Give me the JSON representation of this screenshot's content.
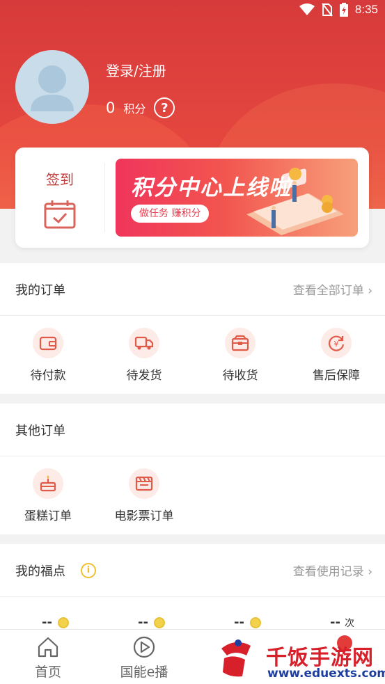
{
  "status_bar": {
    "time": "8:35"
  },
  "profile": {
    "login_label": "登录/注册",
    "points_value": "0",
    "points_unit": "积分",
    "help_glyph": "?"
  },
  "checkin": {
    "label": "签到"
  },
  "banner": {
    "title": "积分中心上线啦",
    "subtitle": "做任务 赚积分"
  },
  "my_orders": {
    "title": "我的订单",
    "view_all": "查看全部订单",
    "items": [
      {
        "label": "待付款",
        "icon": "wallet-icon"
      },
      {
        "label": "待发货",
        "icon": "truck-icon"
      },
      {
        "label": "待收货",
        "icon": "package-icon"
      },
      {
        "label": "售后保障",
        "icon": "refund-icon"
      }
    ]
  },
  "other_orders": {
    "title": "其他订单",
    "items": [
      {
        "label": "蛋糕订单",
        "icon": "cake-icon"
      },
      {
        "label": "电影票订单",
        "icon": "film-icon"
      }
    ]
  },
  "fudian": {
    "title": "我的福点",
    "view_records": "查看使用记录",
    "values": [
      "--",
      "--",
      "--",
      "--"
    ],
    "last_unit": "次"
  },
  "tabbar": {
    "tabs": [
      {
        "label": "首页",
        "icon": "home-icon"
      },
      {
        "label": "国能e播",
        "icon": "play-icon"
      },
      {
        "label": "",
        "icon": ""
      },
      {
        "label": "",
        "icon": ""
      }
    ]
  },
  "watermark": {
    "name": "千饭手游网",
    "url": "www.eduexts.com"
  },
  "colors": {
    "brand_red": "#d63a3a",
    "icon_bg": "#fcebe6",
    "icon_stroke": "#e05a4a",
    "muted": "#999999"
  }
}
